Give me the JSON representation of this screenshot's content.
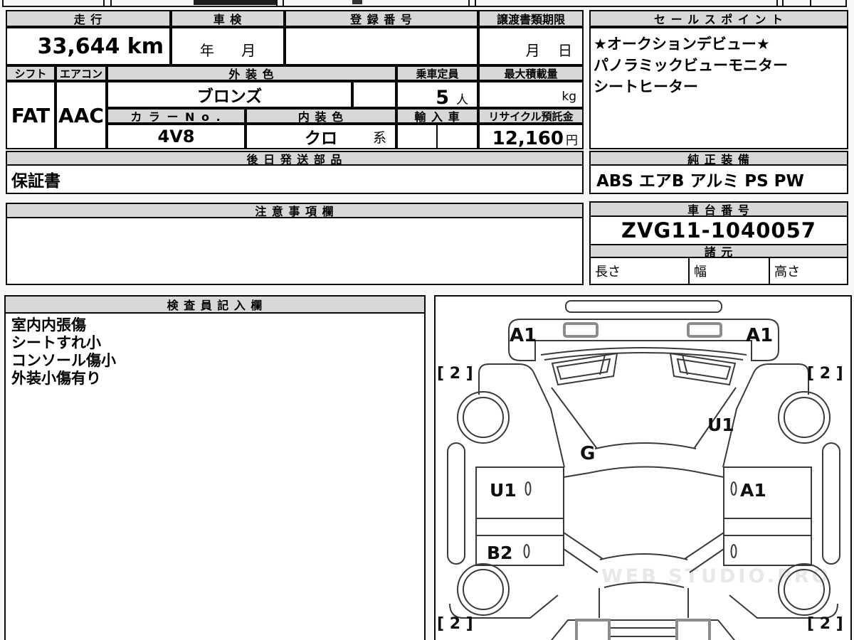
{
  "table": {
    "mileage": {
      "label": "走 行",
      "value": "33,644 km"
    },
    "shaken": {
      "label": "車 検",
      "value": "年      月"
    },
    "registration": {
      "label": "登 録 番 号",
      "value": ""
    },
    "transfer_deadline": {
      "label": "譲渡書類期限",
      "value": "月    日"
    },
    "shift": {
      "label": "シフト",
      "value": "FAT"
    },
    "aircon": {
      "label": "エアコン",
      "value": "AAC"
    },
    "exterior_color": {
      "label": "外 装 色",
      "value": "ブロンズ"
    },
    "capacity": {
      "label": "乗車定員",
      "value": "5",
      "unit": "人"
    },
    "max_load": {
      "label": "最大積載量",
      "value": "",
      "unit": "kg"
    },
    "color_no": {
      "label": "カ ラ ー N o .",
      "value": "4V8"
    },
    "interior_color": {
      "label": "内 装 色",
      "value": "クロ",
      "suffix": "系"
    },
    "import_car": {
      "label": "輸 入 車",
      "value": ""
    },
    "recycle_deposit": {
      "label": "リサイクル預託金",
      "value": "12,160",
      "unit": "円"
    },
    "later_parts": {
      "label": "後 日 発 送 部 品",
      "value": "保証書"
    }
  },
  "sales_point": {
    "label": "セ ー ル ス ポ イ ン ト",
    "lines": [
      "★オークションデビュー★",
      "パノラミックビューモニター",
      "シートヒーター"
    ]
  },
  "equipment": {
    "label": "純 正 装 備",
    "value": "ABS エアB アルミ PS PW"
  },
  "notes": {
    "label": "注 意 事 項 欄",
    "value": ""
  },
  "chassis": {
    "label": "車 台 番 号",
    "value": "ZVG11-1040057"
  },
  "specs": {
    "label": "諸 元",
    "length_label": "長さ",
    "width_label": "幅",
    "height_label": "高さ"
  },
  "inspector": {
    "label": "検 査 員 記 入 欄",
    "lines": [
      "室内内張傷",
      "シートすれ小",
      "コンソール傷小",
      "外装小傷有り"
    ]
  },
  "diagram": {
    "front_left": "A1",
    "front_right": "A1",
    "tire_front_left": "[ 2 ]",
    "tire_front_right": "[ 2 ]",
    "right_fender": "U1",
    "glass": "G",
    "left_front_door": "U1",
    "right_front_door": "A1",
    "left_rear_door": "B2",
    "tire_rear_left": "[ 2 ]",
    "tire_rear_right": "[ 2 ]",
    "watermark": "WEB STUDIO.PRO"
  },
  "colors": {
    "header_bg": "#d8d8d8",
    "border": "#0a0a0a",
    "watermark": "#e8e8e8"
  }
}
